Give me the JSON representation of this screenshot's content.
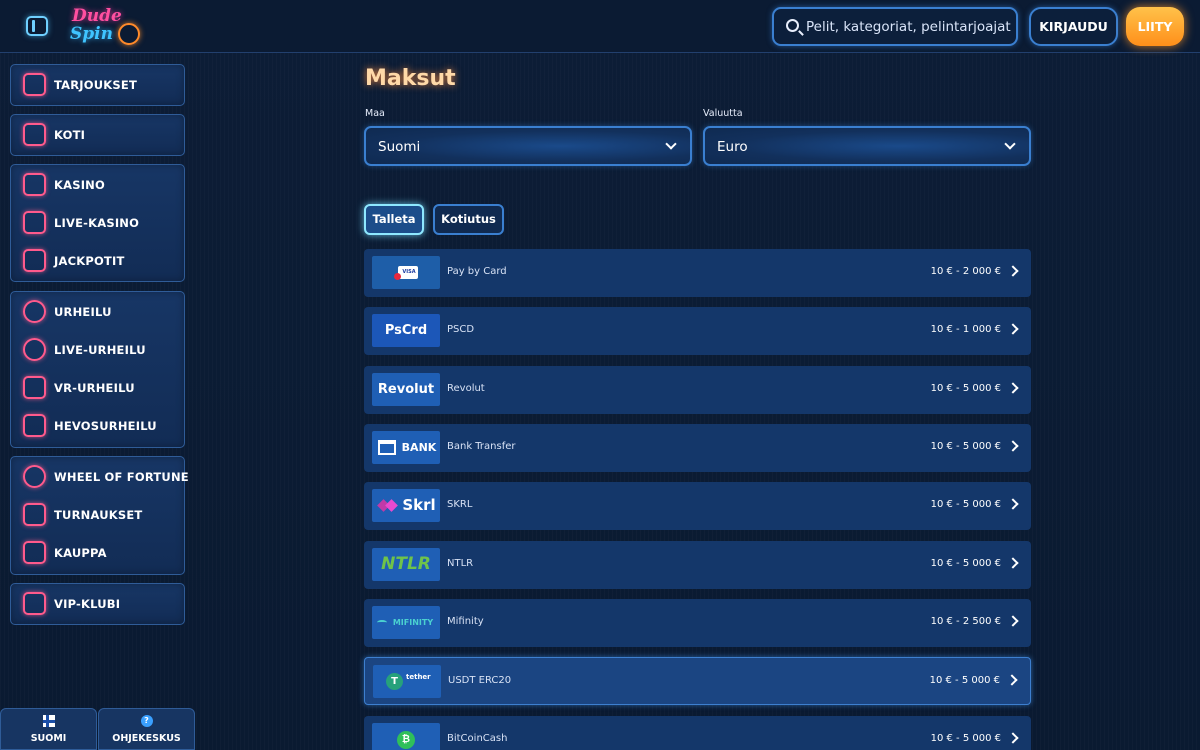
{
  "header": {
    "logo_line1": "Dude",
    "logo_line2": "Spin",
    "search_placeholder": "Pelit, kategoriat, pelintarjoajat",
    "login_label": "KIRJAUDU",
    "join_label": "LIITY"
  },
  "sidebar": {
    "groups": [
      [
        {
          "label": "TARJOUKSET",
          "icon": "megaphone-icon"
        }
      ],
      [
        {
          "label": "KOTI",
          "icon": "home-icon"
        }
      ],
      [
        {
          "label": "KASINO",
          "icon": "spade-icon"
        },
        {
          "label": "LIVE-KASINO",
          "icon": "cards-icon"
        },
        {
          "label": "JACKPOTIT",
          "icon": "sevens-icon"
        }
      ],
      [
        {
          "label": "URHEILU",
          "icon": "ball-icon"
        },
        {
          "label": "LIVE-URHEILU",
          "icon": "live-icon"
        },
        {
          "label": "VR-URHEILU",
          "icon": "gamepad-icon"
        },
        {
          "label": "HEVOSURHEILU",
          "icon": "horse-icon"
        }
      ],
      [
        {
          "label": "WHEEL OF FORTUNE",
          "icon": "wheel-icon"
        },
        {
          "label": "TURNAUKSET",
          "icon": "trophy-icon"
        },
        {
          "label": "KAUPPA",
          "icon": "shop-bag-icon"
        }
      ],
      [
        {
          "label": "VIP-KLUBI",
          "icon": "crown-icon"
        }
      ]
    ]
  },
  "bottom_bar": {
    "language_label": "SUOMI",
    "help_label": "OHJEKESKUS"
  },
  "main": {
    "title": "Maksut",
    "country_label": "Maa",
    "country_value": "Suomi",
    "currency_label": "Valuutta",
    "currency_value": "Euro",
    "tabs": [
      {
        "label": "Talleta",
        "active": true
      },
      {
        "label": "Kotiutus",
        "active": false
      }
    ],
    "methods": [
      {
        "name": "Pay by Card",
        "logo": "VISA",
        "limits": "10 € - 2 000 €"
      },
      {
        "name": "PSCD",
        "logo": "PsCrd",
        "limits": "10 € - 1 000 €"
      },
      {
        "name": "Revolut",
        "logo": "Revolut",
        "limits": "10 € - 5 000 €"
      },
      {
        "name": "Bank Transfer",
        "logo": "BANK",
        "limits": "10 € - 5 000 €"
      },
      {
        "name": "SKRL",
        "logo": "Skrl",
        "limits": "10 € - 5 000 €"
      },
      {
        "name": "NTLR",
        "logo": "NTLR",
        "limits": "10 € - 5 000 €"
      },
      {
        "name": "Mifinity",
        "logo": "MIFINITY",
        "limits": "10 € - 2 500 €"
      },
      {
        "name": "USDT ERC20",
        "logo": "tether",
        "limits": "10 € - 5 000 €"
      },
      {
        "name": "BitCoinCash",
        "logo": "₿",
        "limits": "10 € - 5 000 €"
      }
    ]
  }
}
